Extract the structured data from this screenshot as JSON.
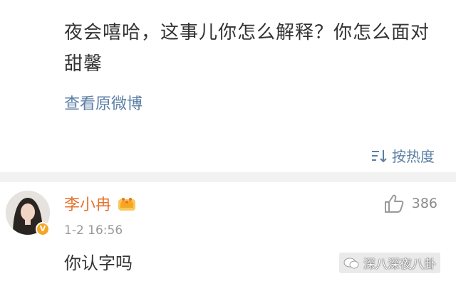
{
  "repost": {
    "text": "夜会嘻哈，这事儿你怎么解释？你怎么面对甜馨",
    "view_original": "查看原微博"
  },
  "sort": {
    "label": "按热度",
    "icon": "sort-lines-icon"
  },
  "comment": {
    "username": "李小冉",
    "time": "1-2 16:56",
    "text": "你认字吗",
    "likes": "386",
    "verified_badge": "V",
    "icons": {
      "avatar": "avatar",
      "crown": "crown-icon",
      "like": "thumbs-up-icon",
      "verified": "verified-badge-icon"
    }
  },
  "watermark": {
    "text": "深八深夜八卦",
    "icon": "wechat-icon"
  },
  "colors": {
    "username": "#e8712b",
    "link": "#5b7ea5",
    "text": "#333333",
    "muted": "#999999",
    "divider": "#f2f2f2",
    "badge": "#f5a623"
  }
}
